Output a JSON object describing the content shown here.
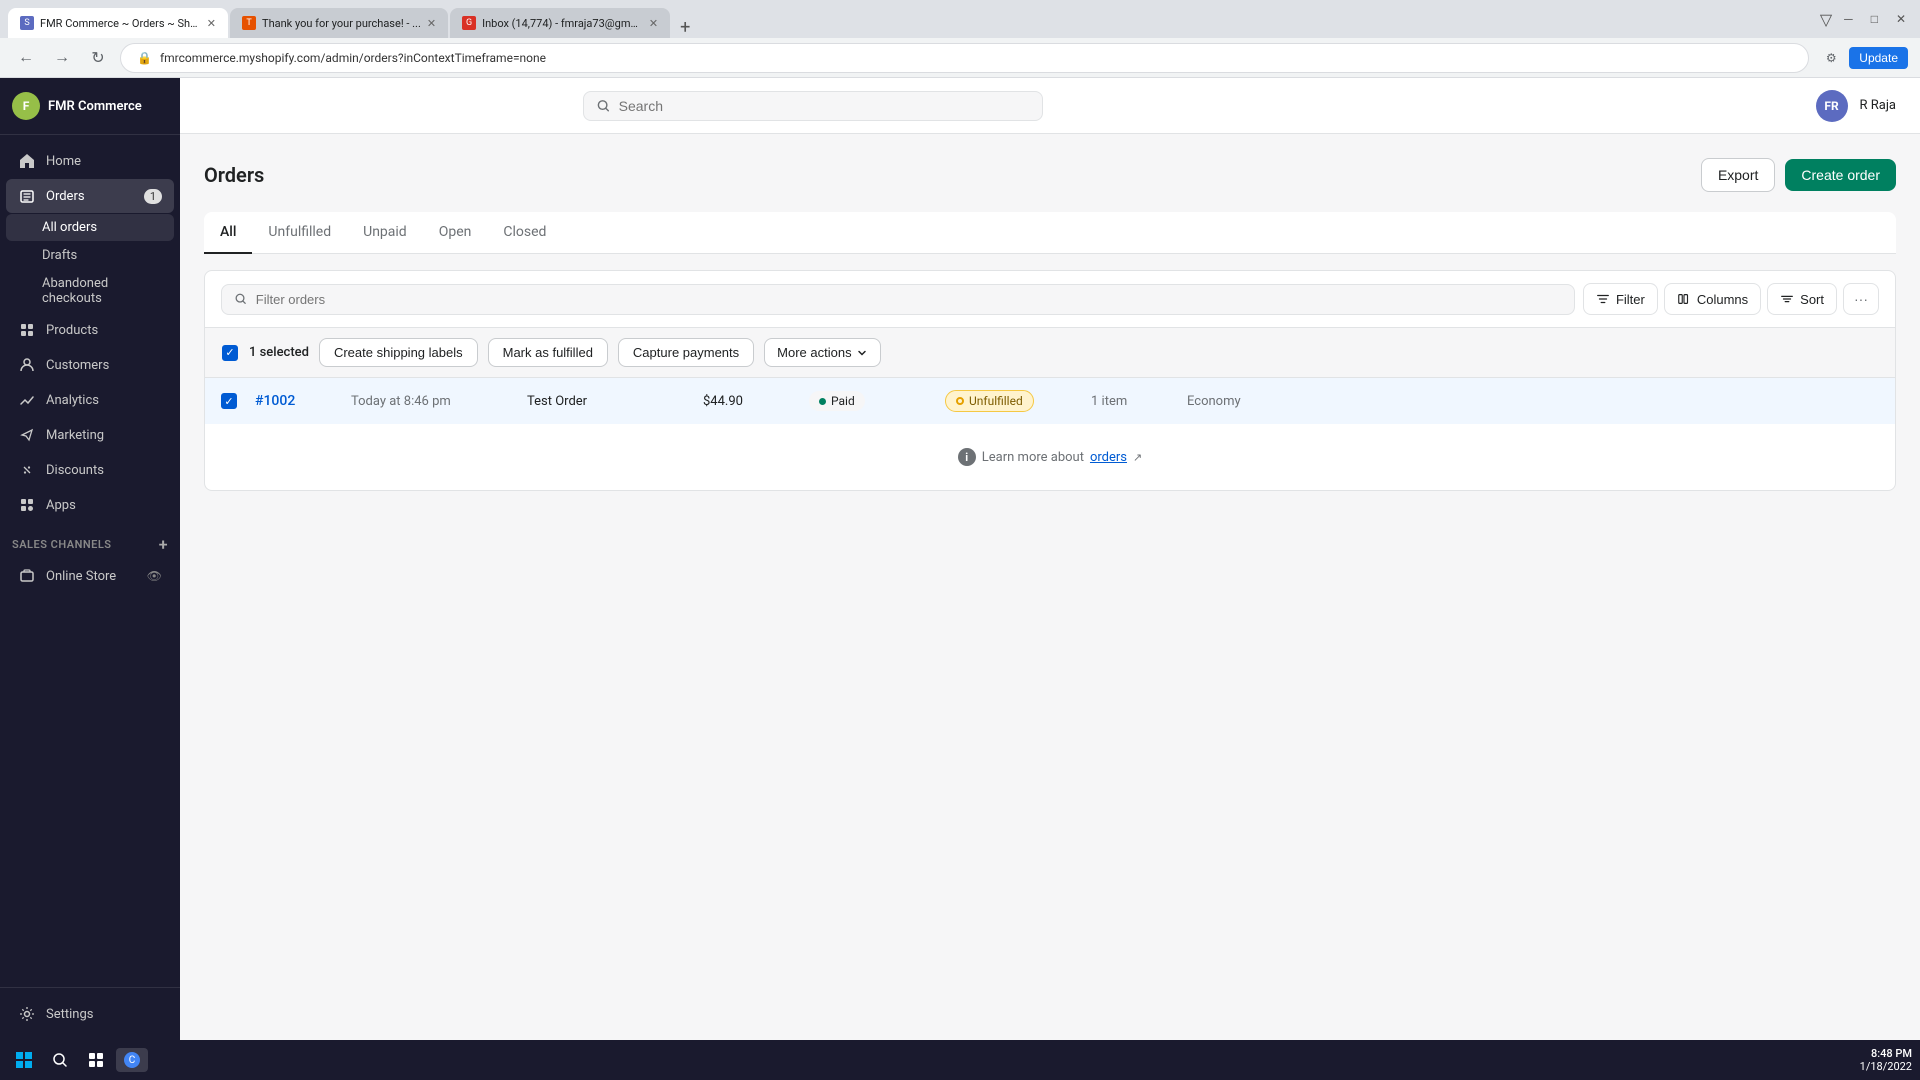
{
  "browser": {
    "tabs": [
      {
        "id": "tab1",
        "title": "FMR Commerce ~ Orders ~ Sho...",
        "favicon": "S",
        "active": true
      },
      {
        "id": "tab2",
        "title": "Thank you for your purchase! - ...",
        "favicon": "T",
        "active": false
      },
      {
        "id": "tab3",
        "title": "Inbox (14,774) - fmraja73@gma...",
        "favicon": "G",
        "active": false
      }
    ],
    "url": "fmrcommerce.myshopify.com/admin/orders?inContextTimeframe=none"
  },
  "topbar": {
    "store_name": "FMR Commerce",
    "search_placeholder": "Search",
    "user_initials": "FR",
    "user_name": "R Raja"
  },
  "sidebar": {
    "logo_text": "F",
    "store_name": "FMR Commerce",
    "nav_items": [
      {
        "id": "home",
        "label": "Home",
        "icon": "home"
      },
      {
        "id": "orders",
        "label": "Orders",
        "icon": "orders",
        "badge": "1",
        "active": true
      },
      {
        "id": "products",
        "label": "Products",
        "icon": "products"
      },
      {
        "id": "customers",
        "label": "Customers",
        "icon": "customers"
      },
      {
        "id": "analytics",
        "label": "Analytics",
        "icon": "analytics"
      },
      {
        "id": "marketing",
        "label": "Marketing",
        "icon": "marketing"
      },
      {
        "id": "discounts",
        "label": "Discounts",
        "icon": "discounts"
      },
      {
        "id": "apps",
        "label": "Apps",
        "icon": "apps"
      }
    ],
    "orders_sub": [
      {
        "id": "all-orders",
        "label": "All orders",
        "active": true
      },
      {
        "id": "drafts",
        "label": "Drafts"
      },
      {
        "id": "abandoned",
        "label": "Abandoned checkouts"
      }
    ],
    "sales_channels_label": "SALES CHANNELS",
    "sales_channels": [
      {
        "id": "online-store",
        "label": "Online Store"
      }
    ],
    "settings_label": "Settings"
  },
  "page": {
    "title": "Orders",
    "export_label": "Export",
    "create_order_label": "Create order"
  },
  "tabs": [
    {
      "id": "all",
      "label": "All",
      "active": true
    },
    {
      "id": "unfulfilled",
      "label": "Unfulfilled"
    },
    {
      "id": "unpaid",
      "label": "Unpaid"
    },
    {
      "id": "open",
      "label": "Open"
    },
    {
      "id": "closed",
      "label": "Closed"
    }
  ],
  "filters": {
    "placeholder": "Filter orders",
    "filter_label": "Filter",
    "columns_label": "Columns",
    "sort_label": "Sort"
  },
  "selection_toolbar": {
    "selected_label": "1 selected",
    "create_shipping_label": "Create shipping labels",
    "mark_fulfilled_label": "Mark as fulfilled",
    "capture_payments_label": "Capture payments",
    "more_actions_label": "More actions"
  },
  "orders": [
    {
      "id": "order-1002",
      "number": "#1002",
      "date": "Today at 8:46 pm",
      "customer": "Test Order",
      "total": "$44.90",
      "payment_status": "Paid",
      "fulfillment_status": "Unfulfilled",
      "items": "1 item",
      "delivery": "Economy",
      "selected": true
    }
  ],
  "info": {
    "text": "Learn more about",
    "link_label": "orders"
  },
  "taskbar": {
    "time": "8:48 PM",
    "date": "1/18/2022"
  }
}
